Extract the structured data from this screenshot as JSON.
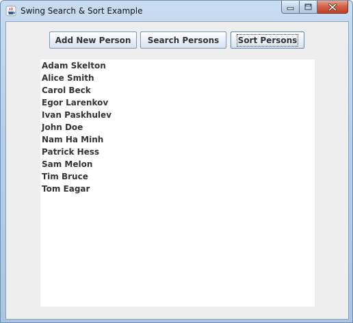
{
  "window": {
    "title": "Swing Search & Sort Example"
  },
  "toolbar": {
    "add_label": "Add New Person",
    "search_label": "Search Persons",
    "sort_label": "Sort Persons"
  },
  "persons": [
    "Adam Skelton",
    "Alice Smith",
    "Carol Beck",
    "Egor Larenkov",
    "Ivan Paskhulev",
    "John Doe",
    "Nam Ha Minh",
    "Patrick Hess",
    "Sam Melon",
    "Tim Bruce",
    "Tom Eagar"
  ],
  "colors": {
    "title_bar": "#b8cfe8",
    "close_button": "#c23f22",
    "client_background": "#eeeeee",
    "list_background": "#ffffff",
    "text": "#333333"
  },
  "icons": {
    "app": "java-icon",
    "minimize": "minimize-icon",
    "maximize": "maximize-icon",
    "close": "close-icon"
  }
}
